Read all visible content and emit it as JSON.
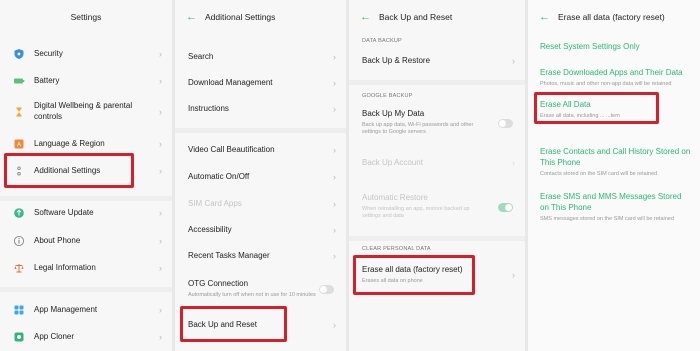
{
  "colors": {
    "accent": "#2bb673",
    "highlight": "#d3202b"
  },
  "panel1": {
    "title": "Settings",
    "items": [
      {
        "label": "Security",
        "icon": "shield-icon"
      },
      {
        "label": "Battery",
        "icon": "battery-icon"
      },
      {
        "label": "Digital Wellbeing & parental controls",
        "icon": "hourglass-icon"
      },
      {
        "label": "Language & Region",
        "icon": "language-icon"
      },
      {
        "label": "Additional Settings",
        "icon": "dots-icon"
      },
      {
        "label": "Software Update",
        "icon": "update-icon"
      },
      {
        "label": "About Phone",
        "icon": "info-icon"
      },
      {
        "label": "Legal Information",
        "icon": "scales-icon"
      },
      {
        "label": "App Management",
        "icon": "app-grid-icon"
      },
      {
        "label": "App Cloner",
        "icon": "app-cloner-icon"
      }
    ]
  },
  "panel2": {
    "title": "Additional Settings",
    "items": [
      {
        "label": "Search"
      },
      {
        "label": "Download Management"
      },
      {
        "label": "Instructions"
      },
      {
        "label": "Video Call Beautification"
      },
      {
        "label": "Automatic On/Off"
      },
      {
        "label": "SIM Card Apps"
      },
      {
        "label": "Accessibility"
      },
      {
        "label": "Recent Tasks Manager"
      },
      {
        "label": "OTG Connection",
        "sub": "Automatically turn off when not in use for 10 minutes"
      },
      {
        "label": "Back Up and Reset"
      }
    ]
  },
  "panel3": {
    "title": "Back Up and Reset",
    "section_data_backup": "DATA BACKUP",
    "backup_restore": "Back Up & Restore",
    "section_google_backup": "GOOGLE BACKUP",
    "backup_my_data": "Back Up My Data",
    "backup_my_data_sub": "Back up app data, Wi-Fi passwords and other settings to Google servers",
    "backup_account": "Back Up Account",
    "automatic_restore": "Automatic Restore",
    "automatic_restore_sub": "When reinstalling an app, restore backed up settings and data",
    "section_clear": "CLEAR PERSONAL DATA",
    "erase_all": "Erase all data (factory reset)",
    "erase_all_sub": "Erases all data on phone"
  },
  "panel4": {
    "title": "Erase all data (factory reset)",
    "options": [
      {
        "label": "Reset System Settings Only",
        "sub": ""
      },
      {
        "label": "Erase Downloaded Apps and Their Data",
        "sub": "Photos, music and other non-app data will be retained"
      },
      {
        "label": "Erase All Data",
        "sub": "Erase all data, including ... ...tem"
      },
      {
        "label": "Erase Contacts and Call History Stored on This Phone",
        "sub": "Contacts stored on the SIM card will be retained"
      },
      {
        "label": "Erase SMS and MMS Messages Stored on This Phone",
        "sub": "SMS messages stored on the SIM card will be retained"
      }
    ]
  }
}
